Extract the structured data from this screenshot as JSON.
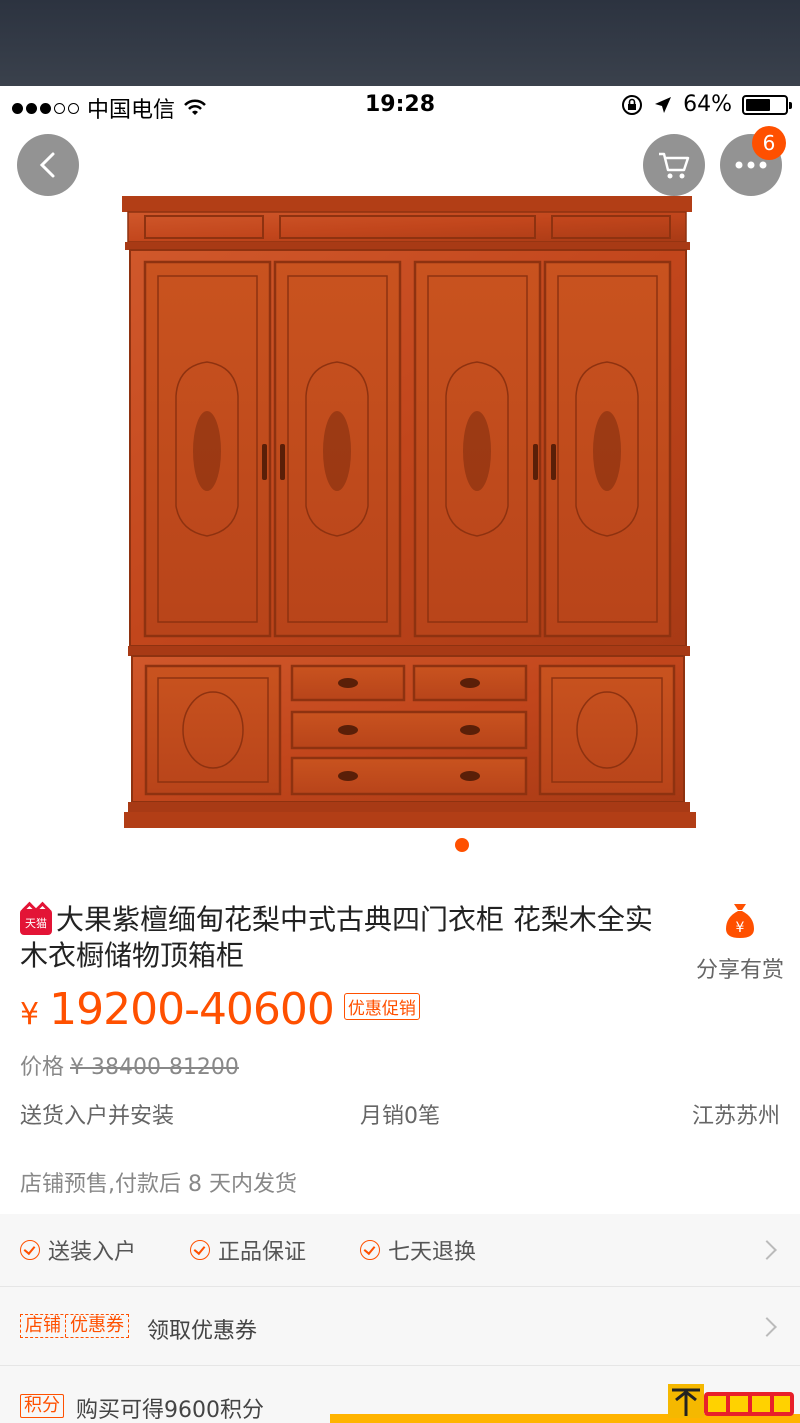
{
  "status_bar": {
    "carrier": "中国电信",
    "time": "19:28",
    "battery": "64%",
    "battery_level": 0.64
  },
  "nav": {
    "more_badge": "6"
  },
  "gallery": {
    "image_alt": "wardrobe-product-image",
    "active_slide": 1
  },
  "product": {
    "store_tag": "天猫",
    "title": "大果紫檀缅甸花梨中式古典四门衣柜 花梨木全实木衣橱储物顶箱柜",
    "currency": "¥",
    "price": "19200-40600",
    "promo_label": "优惠促销",
    "orig_label": "价格",
    "orig_price": "¥ 38400-81200",
    "delivery": "送货入户并安装",
    "monthly_sales": "月销0笔",
    "location": "江苏苏州",
    "presale": "店铺预售,付款后 8 天内发货",
    "share_label": "分享有赏",
    "share_symbol": "¥"
  },
  "services": [
    "送装入户",
    "正品保证",
    "七天退换"
  ],
  "coupon": {
    "tag_left": "店铺",
    "tag_right": "优惠券",
    "text": "领取优惠券"
  },
  "points": {
    "tag": "积分",
    "text": "购买可得9600积分"
  },
  "colors": {
    "accent": "#ff5000",
    "wood": "#c2461c",
    "tmall": "#e31436"
  }
}
